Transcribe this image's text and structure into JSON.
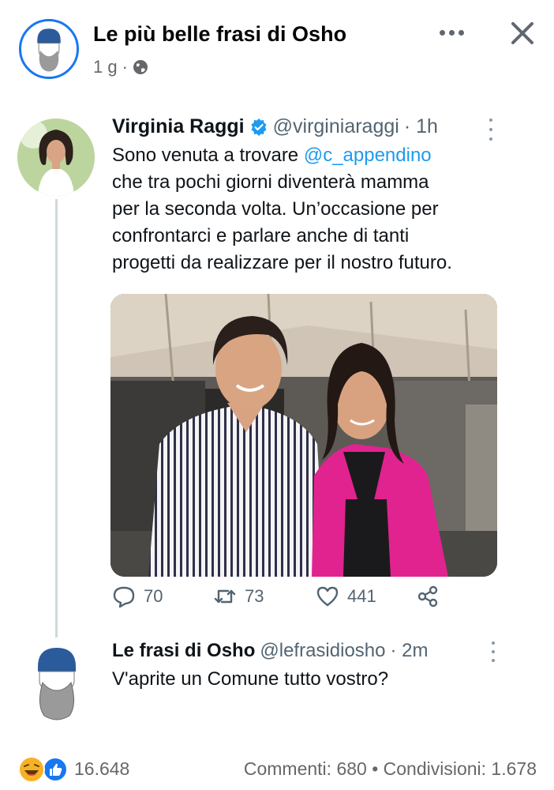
{
  "post": {
    "page_name": "Le più belle frasi di Osho",
    "age": "1 g",
    "separator": "·",
    "privacy_icon": "globe-icon"
  },
  "tweet": {
    "author_name": "Virginia Raggi",
    "handle": "@virginiaraggi",
    "time": "· 1h",
    "text_lines": [
      {
        "before": "Sono venuta a trovare ",
        "mention": "@c_appendino"
      },
      {
        "before": "che tra pochi giorni diventerà mamma",
        "mention": ""
      },
      {
        "before": "per la seconda volta. Un’occasione per",
        "mention": ""
      },
      {
        "before": "confrontarci e parlare anche di tanti",
        "mention": ""
      },
      {
        "before": "progetti da realizzare per il nostro futuro.",
        "mention": ""
      }
    ],
    "replies": "70",
    "retweets": "73",
    "likes": "441"
  },
  "reply": {
    "author_name": "Le frasi di Osho",
    "handle": "@lefrasidiosho",
    "time": "· 2m",
    "text": "V'aprite un Comune tutto vostro?"
  },
  "footer": {
    "reactions_count": "16.648",
    "stats": "Commenti: 680 • Condivisioni: 1.678"
  },
  "colors": {
    "fb_blue": "#1877f2",
    "twitter_blue": "#1d9bf0",
    "secondary_text": "#65676b",
    "jacket_pink": "#e0238f"
  }
}
